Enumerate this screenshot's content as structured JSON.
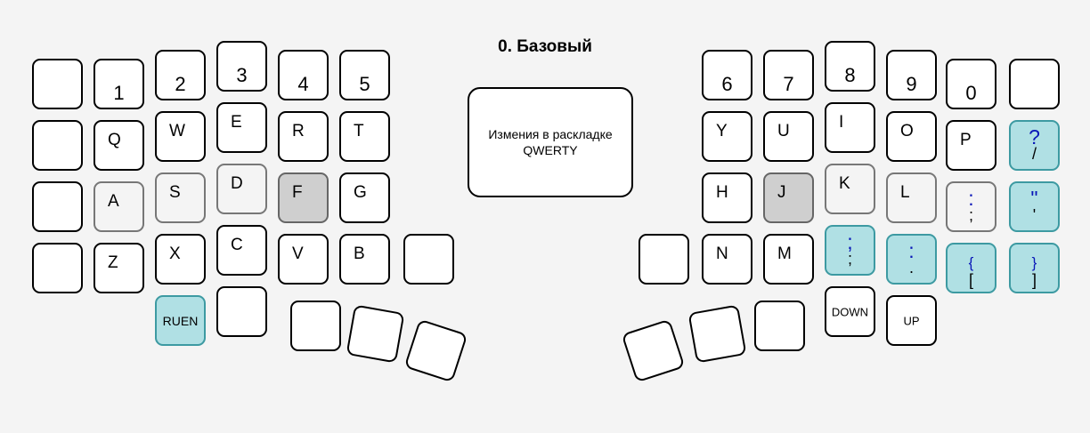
{
  "title": "0. Базовый",
  "note": "Измения в раскладке QWERTY",
  "left": {
    "numbers": [
      "",
      "1",
      "2",
      "3",
      "4",
      "5"
    ],
    "row_top": [
      "",
      "Q",
      "W",
      "E",
      "R",
      "T"
    ],
    "row_home": [
      "",
      "A",
      "S",
      "D",
      "F",
      "G"
    ],
    "row_bottom": [
      "",
      "Z",
      "X",
      "C",
      "V",
      "B"
    ],
    "bottom_mods": [
      "RUEN",
      ""
    ]
  },
  "right": {
    "numbers": [
      "6",
      "7",
      "8",
      "9",
      "0",
      ""
    ],
    "row_top": [
      "Y",
      "U",
      "I",
      "O",
      "P"
    ],
    "row_home": [
      "H",
      "J",
      "K",
      "L"
    ],
    "row_bottom": [
      "N",
      "M"
    ],
    "bottom_mods": [
      "DOWN",
      "UP"
    ]
  },
  "symbols": {
    "slash": {
      "top": "?",
      "bot": "/"
    },
    "quote": {
      "top": "\"",
      "bot": "'"
    },
    "semi_home": {
      "top": ":",
      "bot": ";"
    },
    "semi": {
      "top": ";",
      "bot": ";"
    },
    "period": {
      "top": ":",
      "bot": "."
    },
    "lbracket": {
      "top": "{",
      "bot": "["
    },
    "rbracket": {
      "top": "}",
      "bot": "]"
    }
  },
  "colors": {
    "highlight_light": "#f4f4f4",
    "highlight_dark": "#cfcfcf",
    "symbol_key": "#b0e0e4",
    "symbol_glyph": "#0a17b8"
  }
}
